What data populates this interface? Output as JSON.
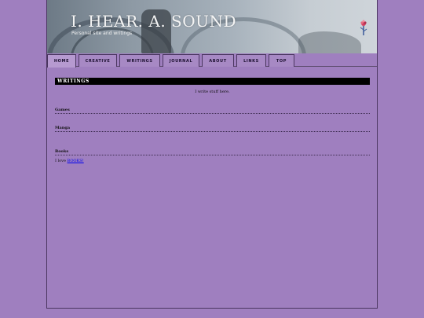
{
  "site": {
    "title": "I. HEAR. A. SOUND",
    "subtitle": "Personal site and writings"
  },
  "nav": {
    "tabs": [
      {
        "label": "HOME",
        "active": true
      },
      {
        "label": "CREATIVE",
        "active": false
      },
      {
        "label": "WRITINGS",
        "active": false
      },
      {
        "label": "JOURNAL",
        "active": false
      },
      {
        "label": "ABOUT",
        "active": false
      },
      {
        "label": "LINKS",
        "active": false
      },
      {
        "label": "TOP",
        "active": false
      }
    ]
  },
  "main": {
    "section_title": "WRITINGS",
    "intro": "I write stuff here.",
    "categories": [
      {
        "label": "Games"
      },
      {
        "label": "Manga"
      },
      {
        "label": "Books"
      }
    ],
    "books_text": "I love ",
    "books_link": "BOOKS!"
  },
  "colors": {
    "background": "#9f7fbf",
    "section_bar": "#000000",
    "link": "#0000ee"
  }
}
